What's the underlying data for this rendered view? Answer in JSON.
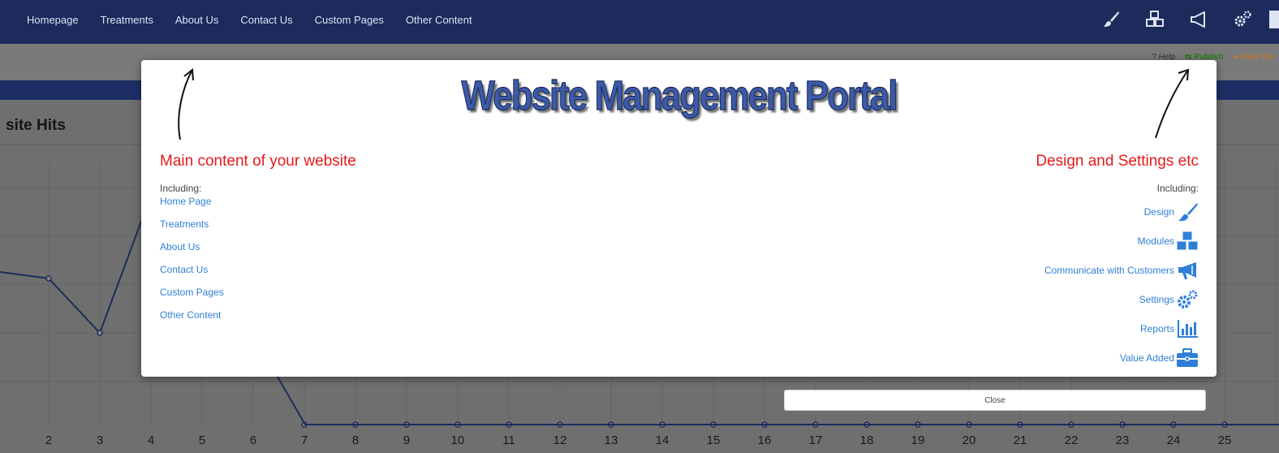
{
  "nav": {
    "links": [
      "Homepage",
      "Treatments",
      "About Us",
      "Contact Us",
      "Custom Pages",
      "Other Content"
    ],
    "icons": [
      "paintbrush-icon",
      "cubes-icon",
      "megaphone-icon",
      "gears-icon"
    ]
  },
  "subbar": {
    "help": "? Help",
    "publish": "Publish",
    "view_site": "View Site"
  },
  "background": {
    "panel_title": "site Hits",
    "x_ticks": [
      "2",
      "3",
      "4",
      "5",
      "6",
      "7",
      "8",
      "9",
      "10",
      "11",
      "12",
      "13",
      "14",
      "15",
      "16",
      "17",
      "18",
      "19",
      "20",
      "21",
      "22",
      "23",
      "24",
      "25"
    ]
  },
  "modal": {
    "banner": "Website Management Portal",
    "left": {
      "heading": "Main content of your website",
      "including": "Including:",
      "links": [
        "Home Page",
        "Treatments",
        "About Us",
        "Contact Us",
        "Custom Pages",
        "Other Content"
      ]
    },
    "right": {
      "heading": "Design and Settings etc",
      "including": "Including:",
      "items": [
        {
          "label": "Design",
          "icon": "paintbrush-icon"
        },
        {
          "label": "Modules",
          "icon": "cubes-icon"
        },
        {
          "label": "Communicate with Customers",
          "icon": "megaphone-icon"
        },
        {
          "label": "Settings",
          "icon": "gears-icon"
        },
        {
          "label": "Reports",
          "icon": "bar-chart-icon"
        },
        {
          "label": "Value Added",
          "icon": "briefcase-icon"
        }
      ]
    },
    "close_label": "Close"
  },
  "colors": {
    "navbar": "#1c2a5c",
    "link": "#2f7fd8",
    "heading_red": "#e51a1a",
    "banner_blue": "#3d5aa8"
  }
}
